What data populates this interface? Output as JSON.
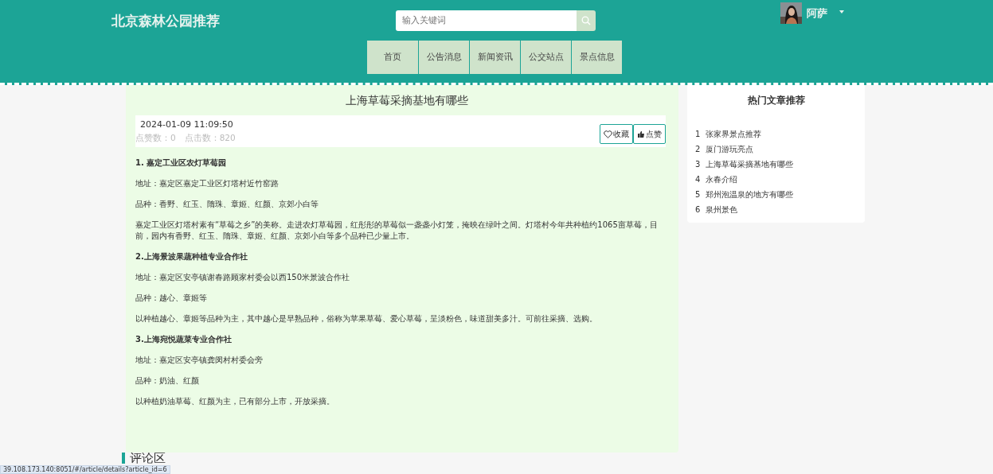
{
  "header": {
    "site_title": "北京森林公园推荐",
    "search": {
      "placeholder": "输入关键词"
    },
    "user": {
      "name": "阿萨"
    },
    "nav": [
      {
        "label": "首页",
        "selected": false
      },
      {
        "label": "公告消息",
        "selected": false
      },
      {
        "label": "新闻资讯",
        "selected": false
      },
      {
        "label": "公交站点",
        "selected": false
      },
      {
        "label": "景点信息",
        "selected": false
      }
    ]
  },
  "article": {
    "title": "上海草莓采摘基地有哪些",
    "date": "2024-01-09 11:09:50",
    "stats": "点赞数：0　点击数：820",
    "buttons": [
      {
        "label": "收藏",
        "kind": "favorite"
      },
      {
        "label": "点赞",
        "kind": "like"
      }
    ],
    "content": [
      {
        "kind": "heading",
        "text": "1. 嘉定工业区农灯草莓园"
      },
      {
        "kind": "paragraph",
        "text": "地址：嘉定区嘉定工业区灯塔村近竹窑路"
      },
      {
        "kind": "paragraph",
        "text": "品种：香野、红玉、隋珠、章姬、红颜、京郊小白等"
      },
      {
        "kind": "paragraph",
        "text": "嘉定工业区灯塔村素有“草莓之乡”的美称。走进农灯草莓园，红彤彤的草莓似一盏盏小灯笼，掩映在绿叶之间。灯塔村今年共种植约1065亩草莓，目前，园内有香野、红玉、隋珠、章姬、红颜、京郊小白等多个品种已少量上市。"
      },
      {
        "kind": "heading",
        "text": "2.上海景波果蔬种植专业合作社"
      },
      {
        "kind": "paragraph",
        "text": "地址：嘉定区安亭镇谢春路顾家村委会以西150米景波合作社"
      },
      {
        "kind": "paragraph",
        "text": "品种：越心、章姬等"
      },
      {
        "kind": "paragraph",
        "text": "以种植越心、章姬等品种为主，其中越心是早熟品种，俗称为苹果草莓、爱心草莓，呈淡粉色，味道甜美多汁。可前往采摘、选购。"
      },
      {
        "kind": "heading",
        "text": "3.上海宛悦蔬菜专业合作社"
      },
      {
        "kind": "paragraph",
        "text": "地址：嘉定区安亭镇龚闵村村委会旁"
      },
      {
        "kind": "paragraph",
        "text": "品种：奶油、红颜"
      },
      {
        "kind": "paragraph",
        "text": "以种植奶油草莓、红颜为主，已有部分上市，开放采摘。"
      }
    ]
  },
  "comments": {
    "heading": "评论区"
  },
  "sidebar": {
    "title": "热门文章推荐",
    "items": [
      {
        "number": "1",
        "label": "张家界景点推荐"
      },
      {
        "number": "2",
        "label": "厦门游玩亮点"
      },
      {
        "number": "3",
        "label": "上海草莓采摘基地有哪些"
      },
      {
        "number": "4",
        "label": "永春介绍"
      },
      {
        "number": "5",
        "label": "郑州泡温泉的地方有哪些"
      },
      {
        "number": "6",
        "label": "泉州景色"
      }
    ]
  },
  "status_bar": {
    "url": "39.108.173.140:8051/#/article/details?article_id=6"
  }
}
